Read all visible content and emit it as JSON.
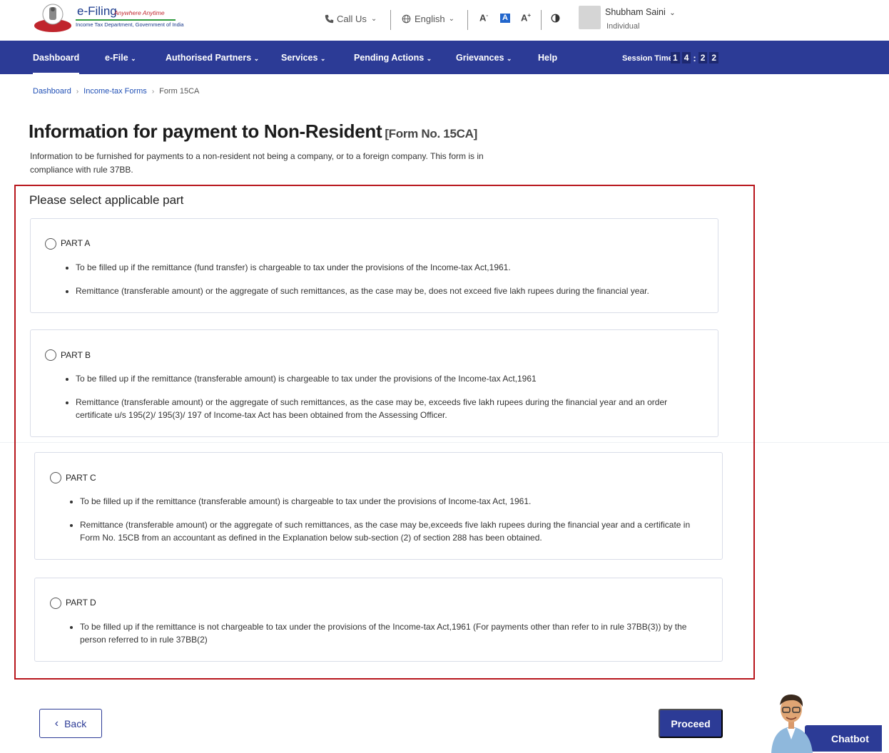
{
  "header": {
    "logo_title": "e-Filing",
    "logo_tagline": "Anywhere Anytime",
    "logo_subtitle": "Income Tax Department, Government of India",
    "call_us": "Call Us",
    "language": "English",
    "font_decrease": "A",
    "font_normal": "A",
    "font_increase": "A",
    "user_name": "Shubham Saini",
    "user_role": "Individual"
  },
  "nav": {
    "items": [
      {
        "label": "Dashboard"
      },
      {
        "label": "e-File"
      },
      {
        "label": "Authorised Partners"
      },
      {
        "label": "Services"
      },
      {
        "label": "Pending Actions"
      },
      {
        "label": "Grievances"
      },
      {
        "label": "Help"
      }
    ],
    "session_label": "Session Time",
    "session_digits": [
      "1",
      "4",
      "2",
      "2"
    ]
  },
  "breadcrumb": {
    "items": [
      "Dashboard",
      "Income-tax Forms",
      "Form 15CA"
    ]
  },
  "page": {
    "title": "Information for payment to Non-Resident",
    "form_no": "[Form No. 15CA]",
    "description": "Information to be furnished for payments to a non-resident not being a company, or to a foreign company. This form is in compliance with rule 37BB.",
    "select_heading": "Please select applicable part"
  },
  "parts": [
    {
      "label": "PART A",
      "bullets": [
        "To be filled up if the remittance (fund transfer) is chargeable to tax under the provisions of the Income-tax Act,1961.",
        "Remittance (transferable amount) or the aggregate of such remittances, as the case may be, does not exceed five lakh rupees during the financial year."
      ]
    },
    {
      "label": "PART B",
      "bullets": [
        "To be filled up if the remittance (transferable amount) is chargeable to tax under the provisions of the Income-tax Act,1961",
        "Remittance (transferable amount) or the aggregate of such remittances, as the case may be, exceeds five lakh rupees during the financial year and an order certificate u/s 195(2)/ 195(3)/ 197 of Income-tax Act has been obtained from the Assessing Officer."
      ]
    },
    {
      "label": "PART C",
      "bullets": [
        "To be filled up if the remittance (transferable amount) is chargeable to tax under the provisions of Income-tax Act, 1961.",
        "Remittance (transferable amount) or the aggregate of such remittances, as the case may be,exceeds five lakh rupees during the financial year and a certificate in Form No. 15CB from an accountant as defined in the Explanation below sub-section (2) of section 288 has been obtained."
      ]
    },
    {
      "label": "PART D",
      "bullets": [
        "To be filled up if the remittance is not chargeable to tax under the provisions of the Income-tax Act,1961 (For payments other than refer to in rule 37BB(3)) by the person referred to in rule 37BB(2)"
      ]
    }
  ],
  "footer": {
    "back_label": "Back",
    "proceed_label": "Proceed",
    "chatbot_label": "Chatbot"
  },
  "colors": {
    "nav_bg": "#2c3b96",
    "highlight_border": "#b8161c",
    "link": "#1f4fb5"
  }
}
